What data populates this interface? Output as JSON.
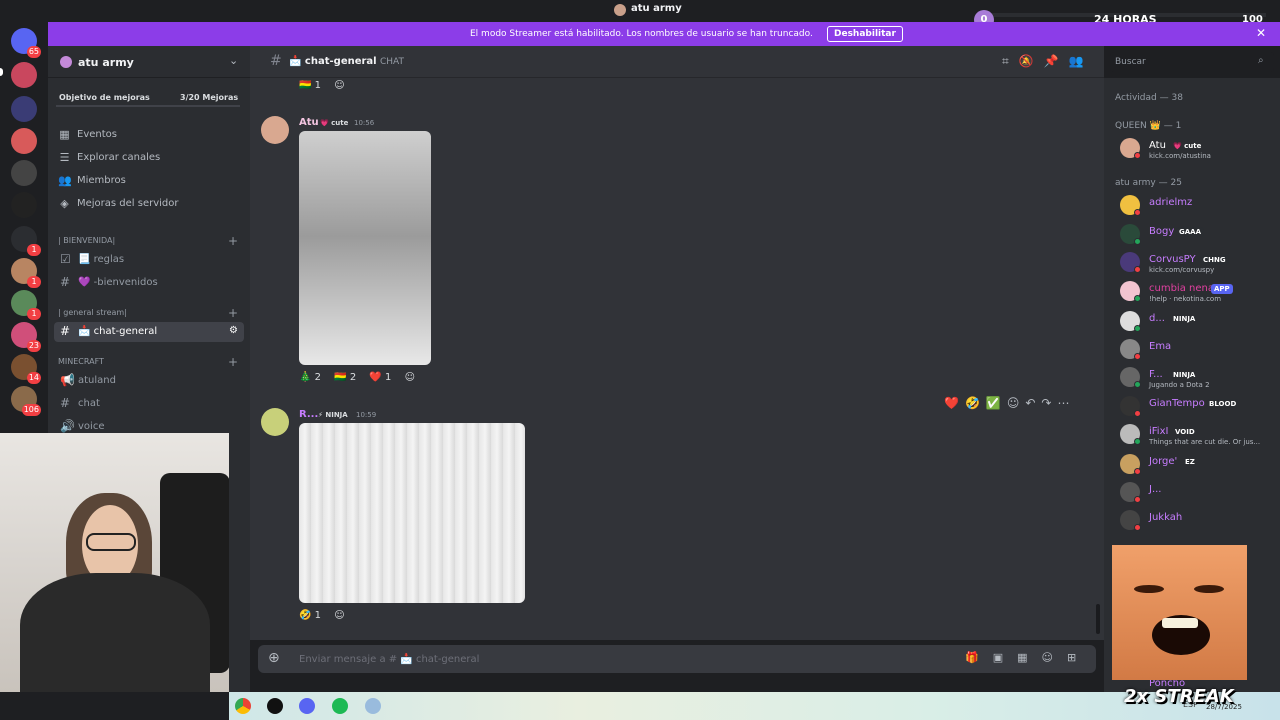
{
  "window": {
    "title": "atu army"
  },
  "streak_bar": {
    "start": "0",
    "label": "24 HORAS",
    "end": "100"
  },
  "banner": {
    "message": "El modo Streamer está habilitado. Los nombres de usuario se han truncado.",
    "button": "Deshabilitar"
  },
  "server": {
    "name": "atu army"
  },
  "server_badges": [
    "65",
    "1",
    "1",
    "1",
    "23",
    "14",
    "106"
  ],
  "boost": {
    "label": "Objetivo de mejoras",
    "count": "3/20 Mejoras"
  },
  "nav": [
    {
      "icon": "calendar-icon",
      "label": "Eventos"
    },
    {
      "icon": "explore-icon",
      "label": "Explorar canales"
    },
    {
      "icon": "members-icon",
      "label": "Miembros"
    },
    {
      "icon": "boost-icon",
      "label": "Mejoras del servidor"
    }
  ],
  "categories": {
    "welcome": "| BIENVENIDA|",
    "general": "| general stream|",
    "minecraft": "MINECRAFT"
  },
  "channels": {
    "reglas": "📃 reglas",
    "bienvenidos": "💜 -bienvenidos",
    "chat_general": "📩 chat-general",
    "atuland": "atuland",
    "chat": "chat",
    "voice": "voice"
  },
  "header": {
    "channel": "📩 chat-general",
    "topic": "CHAT"
  },
  "search": {
    "placeholder": "Buscar"
  },
  "messages": {
    "top_reaction": {
      "emoji": "🇧🇴",
      "count": "1"
    },
    "m1": {
      "author": "Atu",
      "tag": "💗 cute",
      "time": "10:56",
      "reactions": [
        {
          "emoji": "🎄",
          "count": "2"
        },
        {
          "emoji": "🇧🇴",
          "count": "2"
        },
        {
          "emoji": "❤️",
          "count": "1"
        }
      ]
    },
    "m2": {
      "author": "R...",
      "tag": "⚡ NINJA",
      "time": "10:59",
      "reactions": [
        {
          "emoji": "🤣",
          "count": "1"
        }
      ]
    }
  },
  "input": {
    "placeholder": "Enviar mensaje a # 📩 chat-general"
  },
  "members": {
    "activity": "Actividad — 38",
    "queen_header": "QUEEN 👑 — 1",
    "army_header": "atu army — 25",
    "list": [
      {
        "name": "Atu",
        "tag": "💗 cute",
        "status": "kick.com/atustina",
        "color": "#ffffff"
      },
      {
        "name": "adrielmz",
        "tag": "",
        "status": "",
        "color": "#c77dff"
      },
      {
        "name": "Bogy",
        "tag": "GAAA",
        "status": "",
        "color": "#c77dff"
      },
      {
        "name": "CorvusPY",
        "tag": "CHNG",
        "status": "kick.com/corvuspy",
        "color": "#c77dff"
      },
      {
        "name": "cumbia nena",
        "tag": "APP",
        "status": "!help · nekotina.com",
        "color": "#e040a0"
      },
      {
        "name": "d...",
        "tag": "NINJA",
        "status": "",
        "color": "#c77dff"
      },
      {
        "name": "Ema",
        "tag": "",
        "status": "",
        "color": "#c77dff"
      },
      {
        "name": "F...",
        "tag": "NINJA",
        "status": "Jugando a Dota 2",
        "color": "#c77dff"
      },
      {
        "name": "GianTempo",
        "tag": "BLOOD",
        "status": "",
        "color": "#c77dff"
      },
      {
        "name": "iFixI",
        "tag": "VOID",
        "status": "Things that are cut die. Or jus...",
        "color": "#c77dff"
      },
      {
        "name": "Jorge'",
        "tag": "EZ",
        "status": "",
        "color": "#c77dff"
      },
      {
        "name": "J...",
        "tag": "",
        "status": "",
        "color": "#c77dff"
      },
      {
        "name": "Jukkah",
        "tag": "",
        "status": "",
        "color": "#c77dff"
      },
      {
        "name": "Poncho",
        "tag": "",
        "status": "",
        "color": "#c77dff"
      }
    ]
  },
  "overlay": {
    "streak": "2x STREAK"
  },
  "taskbar": {
    "lang": "ESP",
    "date": "28/7/2025"
  },
  "colors": {
    "accent": "#8c3de8",
    "online": "#23a55a",
    "dnd": "#f23f43"
  }
}
